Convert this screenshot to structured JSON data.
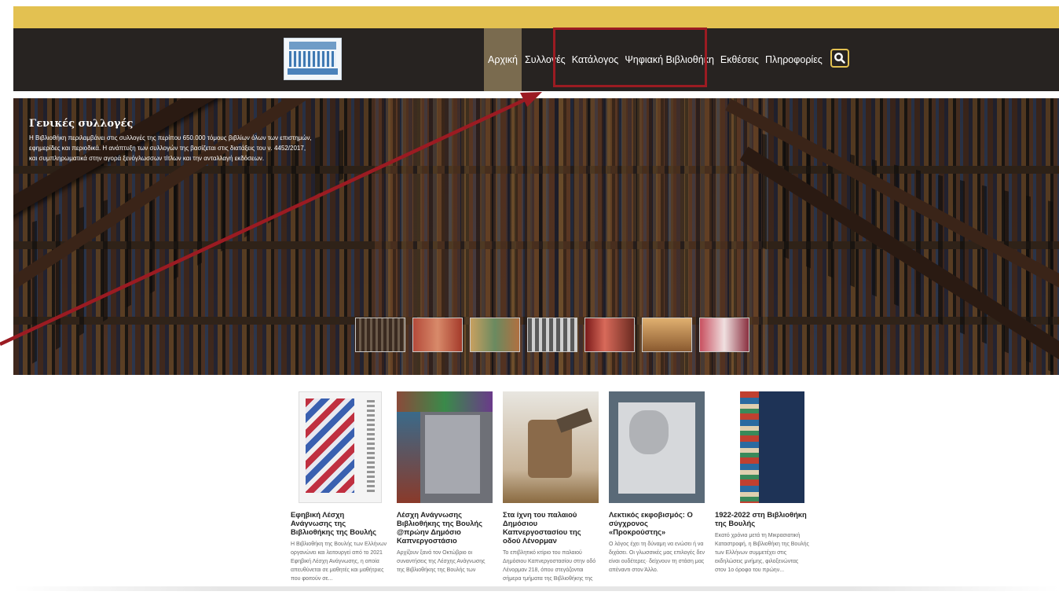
{
  "colors": {
    "accent_gold": "#e3c151",
    "nav_bg": "#272321",
    "active_tab": "#7a6b4f",
    "highlight": "#9b1b22"
  },
  "header": {
    "logo_icon": "parliament-building-logo-icon",
    "nav": [
      {
        "label": "Αρχική",
        "active": true
      },
      {
        "label": "Συλλογές",
        "active": false
      },
      {
        "label": "Κατάλογος",
        "active": false
      },
      {
        "label": "Ψηφιακή Βιβλιοθήκη",
        "active": false
      },
      {
        "label": "Εκθέσεις",
        "active": false
      },
      {
        "label": "Πληροφορίες",
        "active": false
      }
    ],
    "search_icon": "search-icon"
  },
  "hero": {
    "title": "Γενικές συλλογές",
    "description": "Η Βιβλιοθήκη περιλαμβάνει στις συλλογές της περίπου 650.000 τόμους βιβλίων όλων των επιστημών, εφημερίδες και περιοδικά. Η ανάπτυξη των συλλογών της βασίζεται στις διατάξεις του ν. 4452/2017, και συμπληρωματικά στην αγορά ξενόγλωσσων τίτλων και την ανταλλαγή εκδόσεων."
  },
  "cards": [
    {
      "title": "Εφηβική Λέσχη Ανάγνωσης της Βιβλιοθήκης της Βουλής",
      "text": "Η Βιβλιοθήκη της Βουλής των Ελλήνων οργανώνει και λειτουργεί από το 2021 Εφηβική Λέσχη Ανάγνωσης, η οποία απευθύνεται σε μαθητές και μαθήτριες που φοιτούν σε..."
    },
    {
      "title": "Λέσχη Ανάγνωσης Βιβλιοθήκης της Βουλής @πρώην Δημόσιο Καπνεργοστάσιο",
      "text": "Αρχίζουν ξανά τον Οκτώβριο οι συναντήσεις της Λέσχης Ανάγνωσης της Βιβλιοθήκης της Βουλής των"
    },
    {
      "title": "Στα ίχνη του παλαιού Δημόσιου Καπνεργοστασίου της οδού Λένορμαν",
      "text": "Το επιβλητικό κτίριο του παλαιού Δημόσιου Καπνεργοστασίου στην οδό Λένορμαν 218, όπου στεγάζονται σήμερα τμήματα της Βιβλιοθήκης της"
    },
    {
      "title": "Λεκτικός εκφοβισμός: Ο σύγχρονος «Προκρούστης»",
      "text": "Ο λόγος έχει τη δύναμη να ενώσει ή να διχάσει. Οι γλωσσικές μας επιλογές δεν είναι ουδέτερες· δείχνουν τη στάση μας απέναντι στον Άλλο."
    },
    {
      "title": "1922-2022 στη Βιβλιοθήκη της Βουλής",
      "text": "Εκατό χρόνια μετά τη Μικρασιατική Καταστροφή, η Βιβλιοθήκη της Βουλής των Ελλήνων συμμετέχει στις εκδηλώσεις μνήμης, φιλοξενώντας στον 1ο όροφο του πρώην..."
    }
  ]
}
